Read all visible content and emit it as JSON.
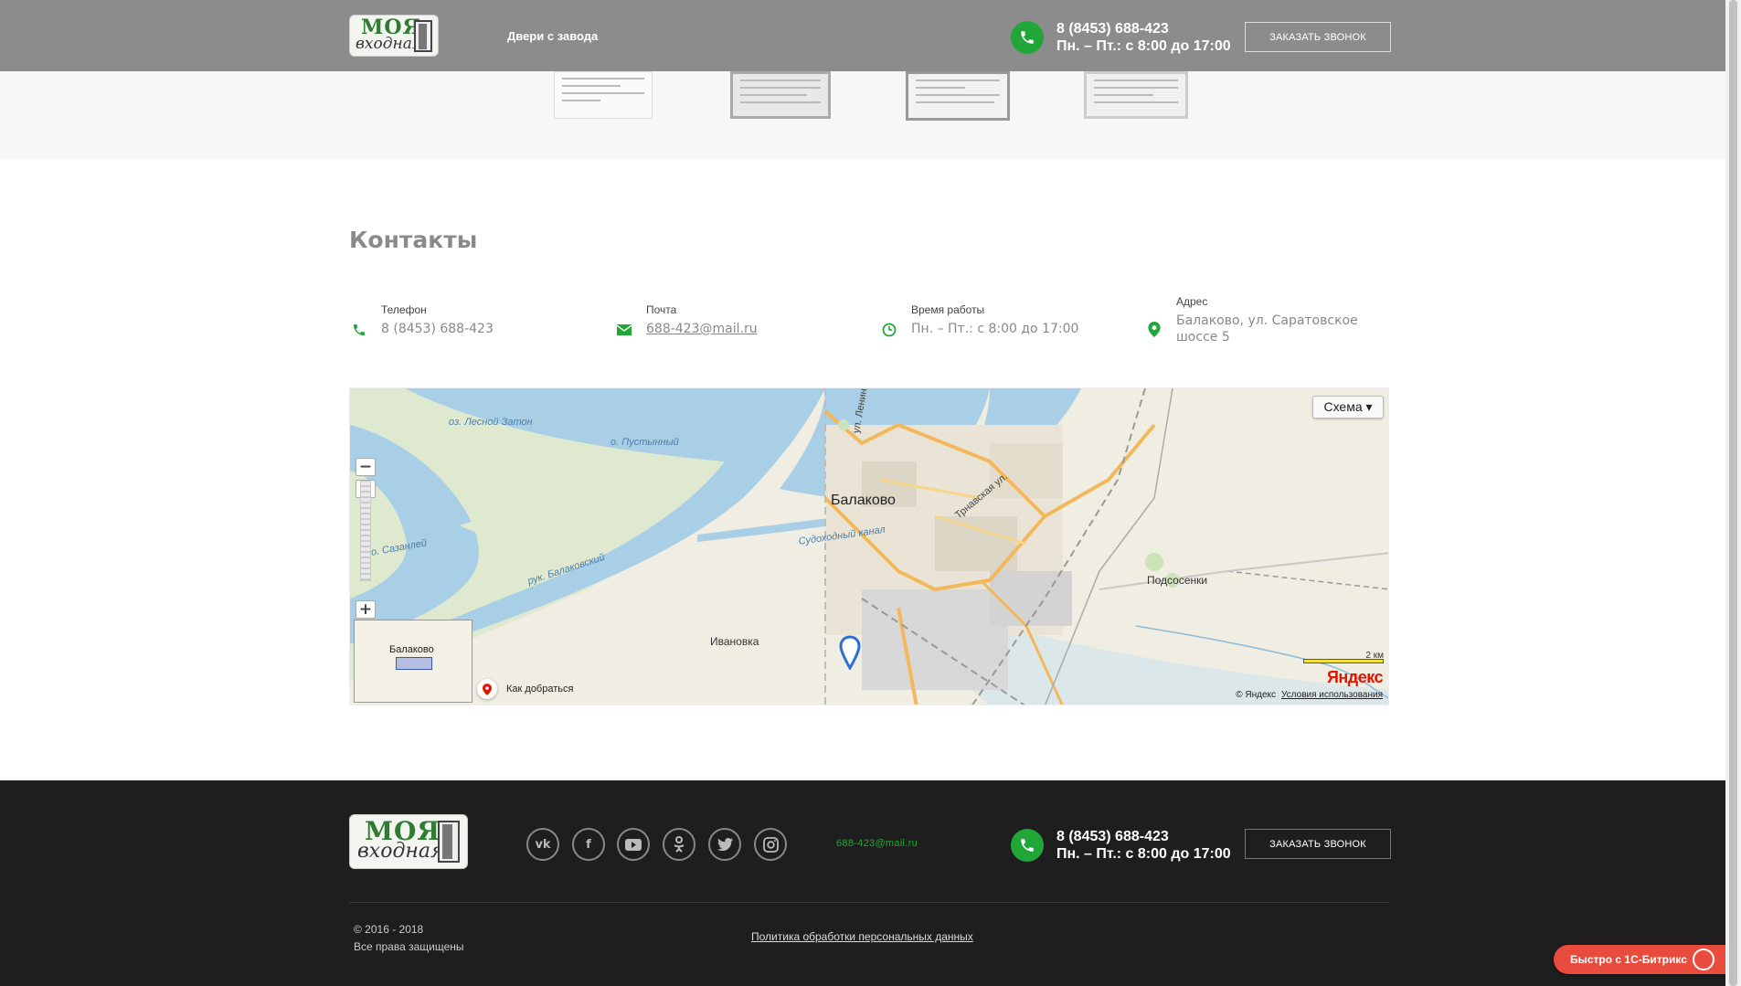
{
  "header": {
    "logo_line1": "МОЯ",
    "logo_line2": "входная",
    "nav_item": "Двери с завода",
    "phone": "8 (8453) 688-423",
    "hours": "Пн. – Пт.: с 8:00 до 17:00",
    "call_button": "Заказать звонок"
  },
  "contacts": {
    "title": "Контакты",
    "items": [
      {
        "label": "Телефон",
        "value": "8 (8453) 688-423",
        "icon": "phone-icon"
      },
      {
        "label": "Почта",
        "value": "688-423@mail.ru",
        "icon": "mail-icon"
      },
      {
        "label": "Время работы",
        "value": "Пн. – Пт.: с 8:00 до 17:00",
        "icon": "clock-icon"
      },
      {
        "label": "Адрес",
        "value_line1": "Балаково, ул. Саратовское",
        "value_line2": "шоссе 5",
        "icon": "location-pin-icon"
      }
    ]
  },
  "map": {
    "scheme_button": "Схема ▾",
    "labels": {
      "lake": "оз. Лесной Затон",
      "island": "о. Пустынный",
      "city": "Балаково",
      "street1": "ул. Ленина",
      "street2": "Трнавская ул.",
      "canal": "Судоходный канал",
      "river_arm": "рук. Балаковский",
      "river_arm2": "о. Сазанлей",
      "village1": "Ивановка",
      "village2": "Подсосенки"
    },
    "minimap_label": "Балаково",
    "route_label": "Как добраться",
    "scale_label": "2 км",
    "yandex_logo": "Яндекс",
    "copyright": "© Яндекс",
    "terms": "Условия использования"
  },
  "footer": {
    "logo_line1": "МОЯ",
    "logo_line2": "входная",
    "social": [
      "vk-icon",
      "facebook-icon",
      "youtube-icon",
      "odnoklassniki-icon",
      "twitter-icon",
      "instagram-icon"
    ],
    "email": "688-423@mail.ru",
    "phone": "8 (8453) 688-423",
    "hours": "Пн. – Пт.: с 8:00 до 17:00",
    "call_button": "Заказать звонок",
    "copyright_line1": "© 2016 - 2018",
    "copyright_line2": "Все права защищены",
    "policy": "Политика обработки персональных данных"
  },
  "bitrix_badge": "Быстро с 1С-Битрикс",
  "colors": {
    "accent_green": "#21a737",
    "header_bg": "#8c8c8c",
    "footer_bg": "#1e1e1e",
    "bitrix_red": "#e84c3d"
  }
}
